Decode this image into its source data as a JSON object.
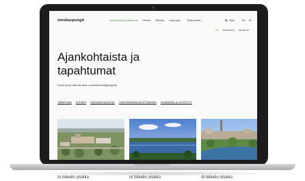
{
  "site": {
    "logo": "innokaupungit",
    "nav": [
      {
        "label": "Ajankohtaista ja tapahtumat",
        "active": true
      },
      {
        "label": "Teemat",
        "active": false
      },
      {
        "label": "Rahoitus",
        "active": false
      },
      {
        "label": "Kaupungit",
        "active": false,
        "caret": "⌄"
      },
      {
        "label": "Tietoa meistä",
        "active": false,
        "caret": "⌄"
      }
    ],
    "search_label": "Haku",
    "languages": [
      "EN",
      "SV"
    ],
    "breadcrumbs": [
      "Koti",
      "Ajankohtaista",
      "Tapahtumat"
    ]
  },
  "hero": {
    "title_line1": "Ajankohtaista ja",
    "title_line2": "tapahtumat",
    "lead": "Lorem ipsum dolor sit amet, consectetur adipiscing elit."
  },
  "tags": [
    "TAPAHTUMA",
    "UUTINEN",
    "INNOVAATIOALUSTAT",
    "LIIKETOIMINNAN KEHITTÄMINEN",
    "OSAAMINEN JA YHTEISTYÖ"
  ],
  "cards": [
    {
      "title": "Ai hkkelin otsikko"
    },
    {
      "title": "Ai hkkelin otsikko"
    },
    {
      "title": "Ai hkkelin otsikko"
    }
  ],
  "colors": {
    "accent": "#4f9a57",
    "frame": "#1c1c1e"
  }
}
